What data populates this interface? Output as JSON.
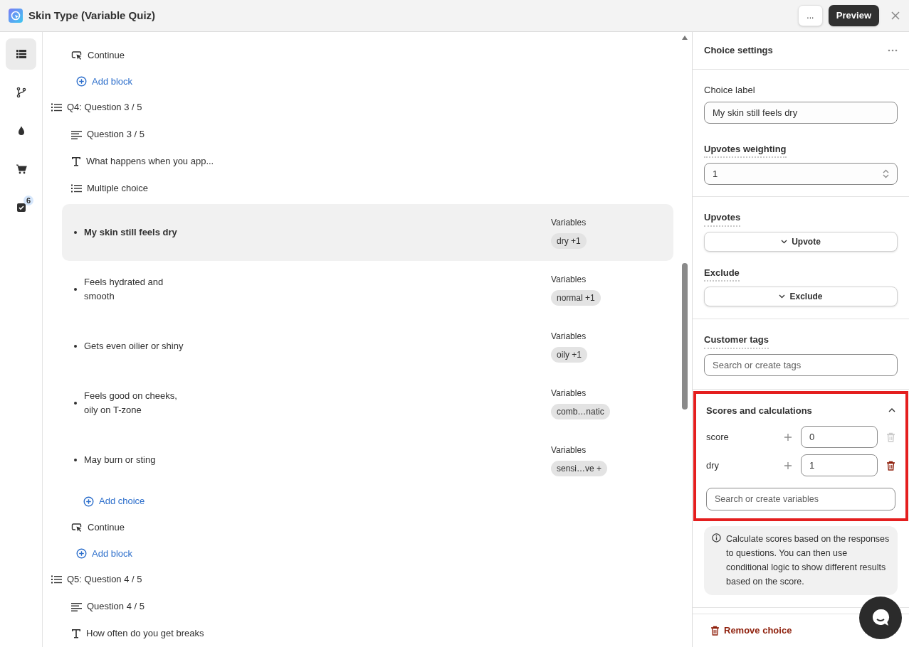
{
  "window": {
    "title": "Skin Type (Variable Quiz)",
    "more_label": "...",
    "preview_label": "Preview"
  },
  "rail": [
    {
      "selected": true
    },
    {
      "selected": false
    },
    {
      "selected": false
    },
    {
      "selected": false
    },
    {
      "selected": false,
      "badge": "6"
    }
  ],
  "outline": [
    {
      "kind": "group",
      "children": [
        {
          "kind": "continue",
          "label": "Continue"
        },
        {
          "kind": "add_block",
          "label": "Add block"
        }
      ]
    },
    {
      "kind": "question",
      "label": "Q4: Question 3 / 5",
      "children": [
        {
          "kind": "heading",
          "label": "Question 3 / 5"
        },
        {
          "kind": "text",
          "label": "What happens when you app..."
        },
        {
          "kind": "multiple_choice",
          "label": "Multiple choice",
          "children": [
            {
              "kind": "choice",
              "label": "My skin still feels dry",
              "selected": true,
              "variables_label": "Variables",
              "variable": "dry +1"
            },
            {
              "kind": "choice",
              "label": "Feels hydrated and smooth",
              "selected": false,
              "variables_label": "Variables",
              "variable": "normal +1"
            },
            {
              "kind": "choice",
              "label": "Gets even oilier or shiny",
              "selected": false,
              "variables_label": "Variables",
              "variable": "oily +1"
            },
            {
              "kind": "choice",
              "label": "Feels good on cheeks, oily on T-zone",
              "selected": false,
              "variables_label": "Variables",
              "variable": "comb…natic"
            },
            {
              "kind": "choice",
              "label": "May burn or sting",
              "selected": false,
              "variables_label": "Variables",
              "variable": "sensi…ve +"
            },
            {
              "kind": "add_choice",
              "label": "Add choice"
            }
          ]
        },
        {
          "kind": "continue",
          "label": "Continue"
        },
        {
          "kind": "add_block",
          "label": "Add block"
        }
      ]
    },
    {
      "kind": "question",
      "label": "Q5: Question 4 / 5",
      "children": [
        {
          "kind": "heading",
          "label": "Question 4 / 5"
        },
        {
          "kind": "text",
          "label": "How often do you get breaks"
        }
      ]
    }
  ],
  "panel": {
    "title": "Choice settings",
    "choice_label": {
      "label": "Choice label",
      "value": "My skin still feels dry"
    },
    "weighting": {
      "label": "Upvotes weighting",
      "value": "1"
    },
    "upvotes": {
      "label": "Upvotes",
      "button": "Upvote"
    },
    "exclude": {
      "label": "Exclude",
      "button": "Exclude"
    },
    "customer_tags": {
      "label": "Customer tags",
      "placeholder": "Search or create tags"
    },
    "scores": {
      "title": "Scores and calculations",
      "expanded": true,
      "highlighted": true,
      "placeholder": "Search or create variables",
      "rows": [
        {
          "name": "score",
          "value": "0",
          "removable": false
        },
        {
          "name": "dry",
          "value": "1",
          "removable": true
        }
      ]
    },
    "info": "Calculate scores based on the responses to questions. You can then use conditional logic to show different results based on the score.",
    "remove_label": "Remove choice"
  }
}
